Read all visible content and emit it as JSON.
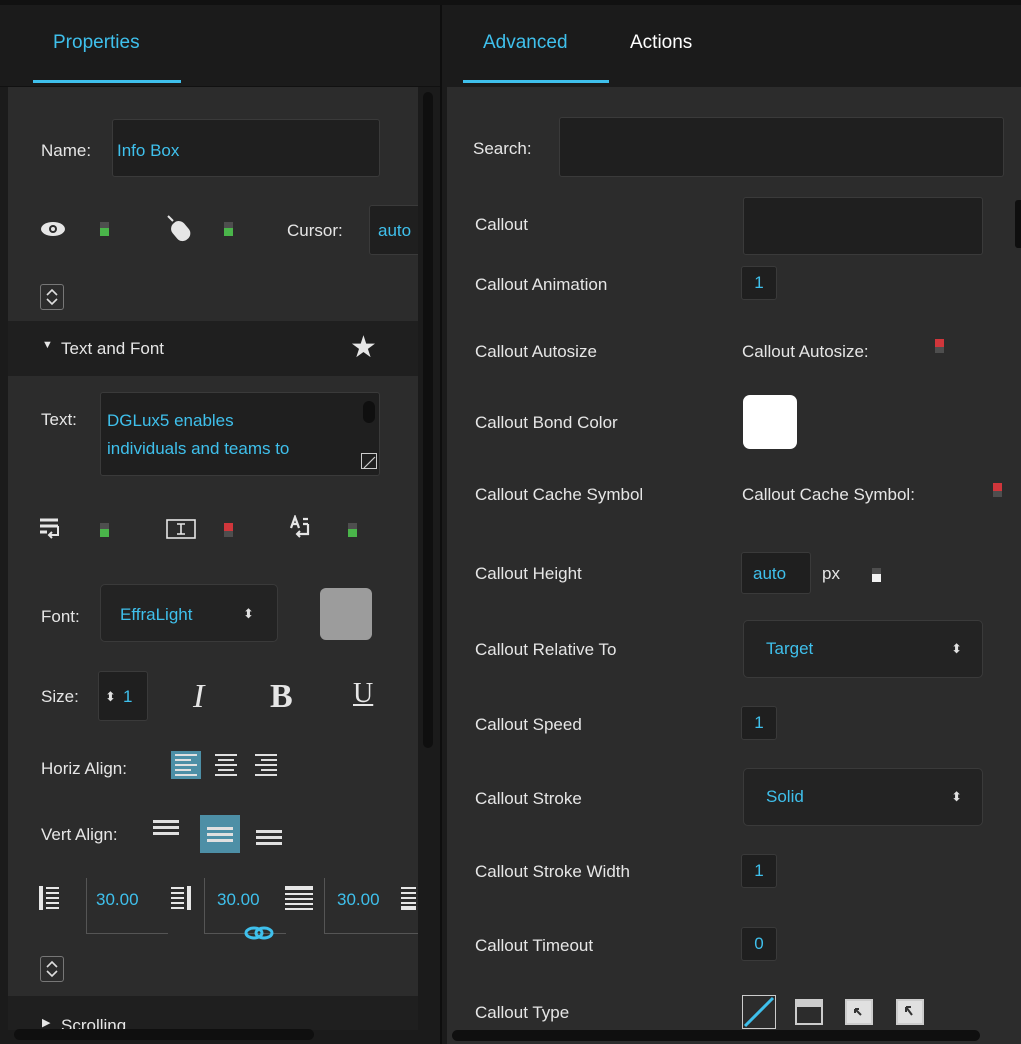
{
  "left_tabs": [
    {
      "label": "Properties",
      "active": true
    }
  ],
  "right_tabs": [
    {
      "label": "Advanced",
      "active": true
    },
    {
      "label": "Actions",
      "active": false
    }
  ],
  "properties": {
    "name_label": "Name:",
    "name_value": "Info Box",
    "cursor_label": "Cursor:",
    "cursor_value": "auto",
    "section_text_font": "Text and Font",
    "text_label": "Text:",
    "text_value_line1": "DGLux5 enables",
    "text_value_line2": "individuals and teams to",
    "font_label": "Font:",
    "font_value": "EffraLight",
    "font_color": "#9c9c9c",
    "size_label": "Size:",
    "size_value": "1",
    "italic_glyph": "I",
    "bold_glyph": "B",
    "underline_glyph": "U",
    "horiz_align_label": "Horiz Align:",
    "vert_align_label": "Vert Align:",
    "padding_values": [
      "30.00",
      "30.00",
      "30.00"
    ],
    "section_scrolling": "Scrolling"
  },
  "advanced": {
    "search_label": "Search:",
    "search_value": "",
    "rows": {
      "callout": "Callout",
      "callout_animation": "Callout Animation",
      "callout_animation_value": "1",
      "callout_autosize": "Callout Autosize",
      "callout_autosize_inline": "Callout Autosize:",
      "callout_bond_color": "Callout Bond Color",
      "callout_bond_color_value": "#ffffff",
      "callout_cache_symbol": "Callout Cache Symbol",
      "callout_cache_symbol_inline": "Callout Cache Symbol:",
      "callout_height": "Callout Height",
      "callout_height_value": "auto",
      "callout_height_unit": "px",
      "callout_relative_to": "Callout Relative To",
      "callout_relative_to_value": "Target",
      "callout_speed": "Callout Speed",
      "callout_speed_value": "1",
      "callout_stroke": "Callout Stroke",
      "callout_stroke_value": "Solid",
      "callout_stroke_width": "Callout Stroke Width",
      "callout_stroke_width_value": "1",
      "callout_timeout": "Callout Timeout",
      "callout_timeout_value": "0",
      "callout_type": "Callout Type"
    }
  },
  "colors": {
    "accent": "#3fc0ec",
    "indicator_green": "#4ab54a",
    "indicator_red": "#d0363b",
    "active_button": "#4d8fa6"
  }
}
